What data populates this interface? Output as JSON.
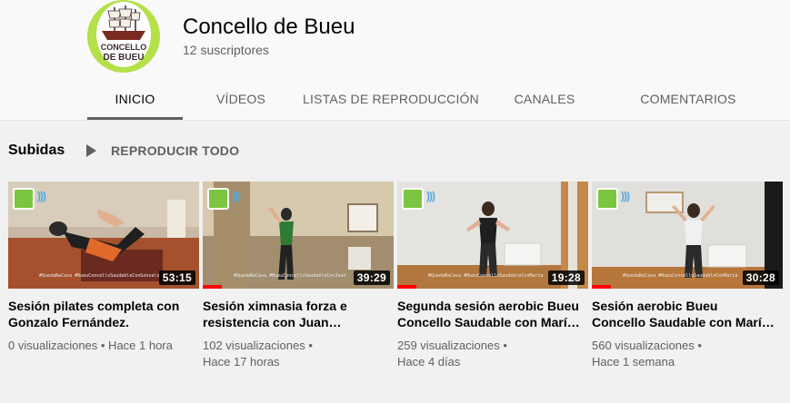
{
  "channel": {
    "name": "Concello de Bueu",
    "subscribers": "12 suscriptores",
    "logo_text_line1": "CONCELLO",
    "logo_text_line2": "DE BUEU"
  },
  "tabs": [
    {
      "label": "INICIO",
      "active": true
    },
    {
      "label": "VÍDEOS",
      "active": false
    },
    {
      "label": "LISTAS DE REPRODUCCIÓN",
      "active": false
    },
    {
      "label": "CANALES",
      "active": false
    },
    {
      "label": "COMENTARIOS",
      "active": false
    }
  ],
  "section": {
    "title": "Subidas",
    "play_all": "REPRODUCIR TODO"
  },
  "videos": [
    {
      "title_line1": "Sesión pilates completa con",
      "title_line2": "Gonzalo Fernández.",
      "duration": "53:15",
      "meta_line1": "0 visualizaciones • Hace 1 hora",
      "meta_line2": "",
      "progress": 0,
      "thumb_hashtag": "#QuedaNaCasa #BueuConcelloSaudableConGonzalo"
    },
    {
      "title_line1": "Sesión ximnasia forza e",
      "title_line2": "resistencia con Juan…",
      "duration": "39:29",
      "meta_line1": "102 visualizaciones •",
      "meta_line2": "Hace 17 horas",
      "progress": 0.1,
      "thumb_hashtag": "#QuedaNaCasa #BueuConcelloSaudableConJuan"
    },
    {
      "title_line1": "Segunda sesión aerobic Bueu",
      "title_line2": "Concello Saudable con Marí…",
      "duration": "19:28",
      "meta_line1": "259 visualizaciones •",
      "meta_line2": "Hace 4 días",
      "progress": 0.1,
      "thumb_hashtag": "#QuedaNaCasa #BueuConcelloSaudableConMaria"
    },
    {
      "title_line1": "Sesión aerobic Bueu",
      "title_line2": "Concello Saudable con Marí…",
      "duration": "30:28",
      "meta_line1": "560 visualizaciones •",
      "meta_line2": "Hace 1 semana",
      "progress": 0.1,
      "thumb_hashtag": "#QuedaNaCasa #BueuConcelloSaudableConMaria"
    }
  ]
}
